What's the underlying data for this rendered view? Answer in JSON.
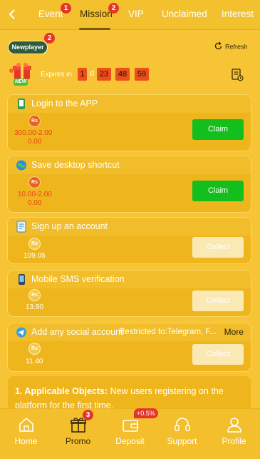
{
  "nav": {
    "tabs": [
      {
        "label": "Event",
        "badge": "1"
      },
      {
        "label": "Mission",
        "badge": "2",
        "active": true
      },
      {
        "label": "VIP"
      },
      {
        "label": "Unclaimed"
      },
      {
        "label": "Interest"
      }
    ]
  },
  "newplayer": {
    "label": "Newplayer",
    "badge": "2"
  },
  "refresh_label": "Refresh",
  "gift_tag": "NEW",
  "expires": {
    "label": "Expires in",
    "days": "1",
    "day_unit": "d",
    "hours": "23",
    "minutes": "48",
    "seconds": "59"
  },
  "currency_symbol": "Rs",
  "missions": [
    {
      "title": "Login to the APP",
      "amount_line1": "300.00-2.00",
      "amount_line2": "0.00",
      "button": "Claim",
      "state": "claim"
    },
    {
      "title": "Save desktop shortcut",
      "amount_line1": "10.00-2.00",
      "amount_line2": "0.00",
      "button": "Claim",
      "state": "claim"
    },
    {
      "title": "Sign up an account",
      "amount_line1": "109.05",
      "button": "Collect",
      "state": "disabled"
    },
    {
      "title": "Mobile SMS verification",
      "amount_line1": "13.90",
      "button": "Collect",
      "state": "disabled"
    },
    {
      "title": "Add any social account",
      "extra": "Restricted to:Telegram, F...",
      "more": "More",
      "amount_line1": "11.40",
      "button": "Collect",
      "state": "disabled"
    }
  ],
  "rules": {
    "heading": "1. Applicable Objects:",
    "text": " New users registering on the platform for the first time."
  },
  "bottom_nav": [
    {
      "label": "Home",
      "icon": "home-icon"
    },
    {
      "label": "Promo",
      "icon": "gift-icon",
      "badge": "3",
      "active": true
    },
    {
      "label": "Deposit",
      "icon": "wallet-icon",
      "tag": "+0.5%"
    },
    {
      "label": "Support",
      "icon": "headset-icon"
    },
    {
      "label": "Profile",
      "icon": "user-icon"
    }
  ],
  "colors": {
    "background": "#f6c434",
    "card": "#efb51d",
    "claim_button": "#14be1c",
    "timer_box": "#ec4e1c",
    "badge": "#e5352b",
    "amount_red": "#ec4415"
  }
}
